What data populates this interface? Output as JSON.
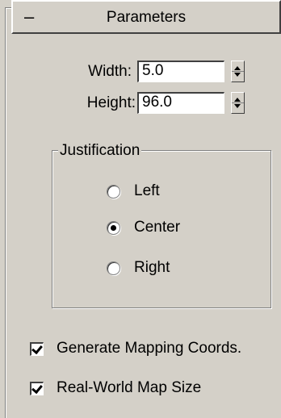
{
  "rollout": {
    "collapse_symbol": "–",
    "title": "Parameters"
  },
  "width": {
    "label": "Width:",
    "value": "5.0"
  },
  "height": {
    "label": "Height:",
    "value": "96.0"
  },
  "justification": {
    "title": "Justification",
    "options": [
      {
        "label": "Left",
        "selected": false
      },
      {
        "label": "Center",
        "selected": true
      },
      {
        "label": "Right",
        "selected": false
      }
    ]
  },
  "options": {
    "generate_mapping": {
      "label": "Generate Mapping Coords.",
      "checked": true
    },
    "real_world": {
      "label": "Real-World Map Size",
      "checked": true
    }
  }
}
